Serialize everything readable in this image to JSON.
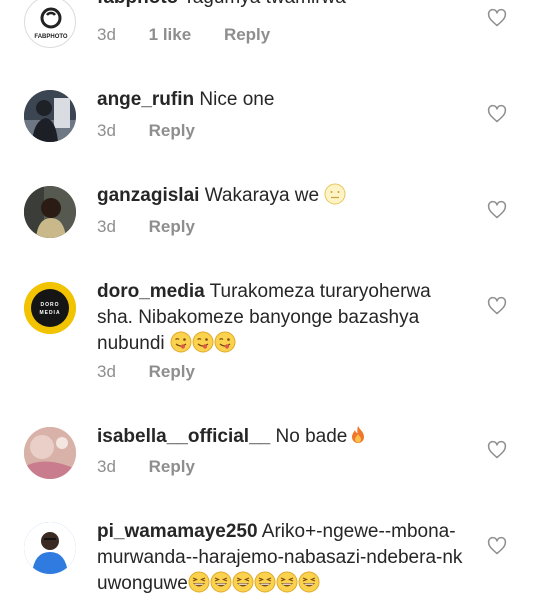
{
  "comments": [
    {
      "username": "fabphoto",
      "text": "Tagumya twamirwa",
      "time": "3d",
      "likes": "1 like",
      "reply": "Reply",
      "avatar_text": "FABPHOTO",
      "avatar_icon": "camera-logo-icon",
      "heart_icon": "heart-outline-icon"
    },
    {
      "username": "ange_rufin",
      "text": "Nice one",
      "time": "3d",
      "reply": "Reply",
      "avatar_icon": "user-photo-avatar",
      "heart_icon": "heart-outline-icon"
    },
    {
      "username": "ganzagislai",
      "text": "Wakaraya we",
      "emojis": [
        "neutral-face-emoji"
      ],
      "time": "3d",
      "reply": "Reply",
      "avatar_icon": "user-photo-avatar",
      "heart_icon": "heart-outline-icon"
    },
    {
      "username": "doro_media",
      "text": "Turakomeza turaryoherwa sha. Nibakomeze banyonge bazashya nubundi",
      "emojis": [
        "winking-tongue-emoji",
        "winking-tongue-emoji",
        "winking-tongue-emoji"
      ],
      "time": "3d",
      "reply": "Reply",
      "avatar_text": "DORO MEDIA",
      "avatar_icon": "doro-media-logo-icon",
      "heart_icon": "heart-outline-icon"
    },
    {
      "username": "isabella__official__",
      "text": "No bade",
      "emojis": [
        "fire-emoji"
      ],
      "time": "3d",
      "reply": "Reply",
      "avatar_icon": "user-photo-avatar",
      "heart_icon": "heart-outline-icon"
    },
    {
      "username": "pi_wamamaye250",
      "text": "Ariko+-ngewe--mbona-murwanda--harajemo-nabasazi-ndebera-nkuwonguwe",
      "emojis": [
        "grinning-squint-emoji",
        "grinning-squint-emoji",
        "grinning-squint-emoji",
        "grinning-squint-emoji",
        "grinning-squint-emoji",
        "grinning-squint-emoji"
      ],
      "avatar_icon": "user-photo-avatar",
      "heart_icon": "heart-outline-icon"
    }
  ],
  "colors": {
    "text": "#262626",
    "secondary": "#8e8e8e",
    "doro_logo_ring": "#f2c300",
    "fire": "#f0772b",
    "emoji_face": "#fbd24e"
  }
}
